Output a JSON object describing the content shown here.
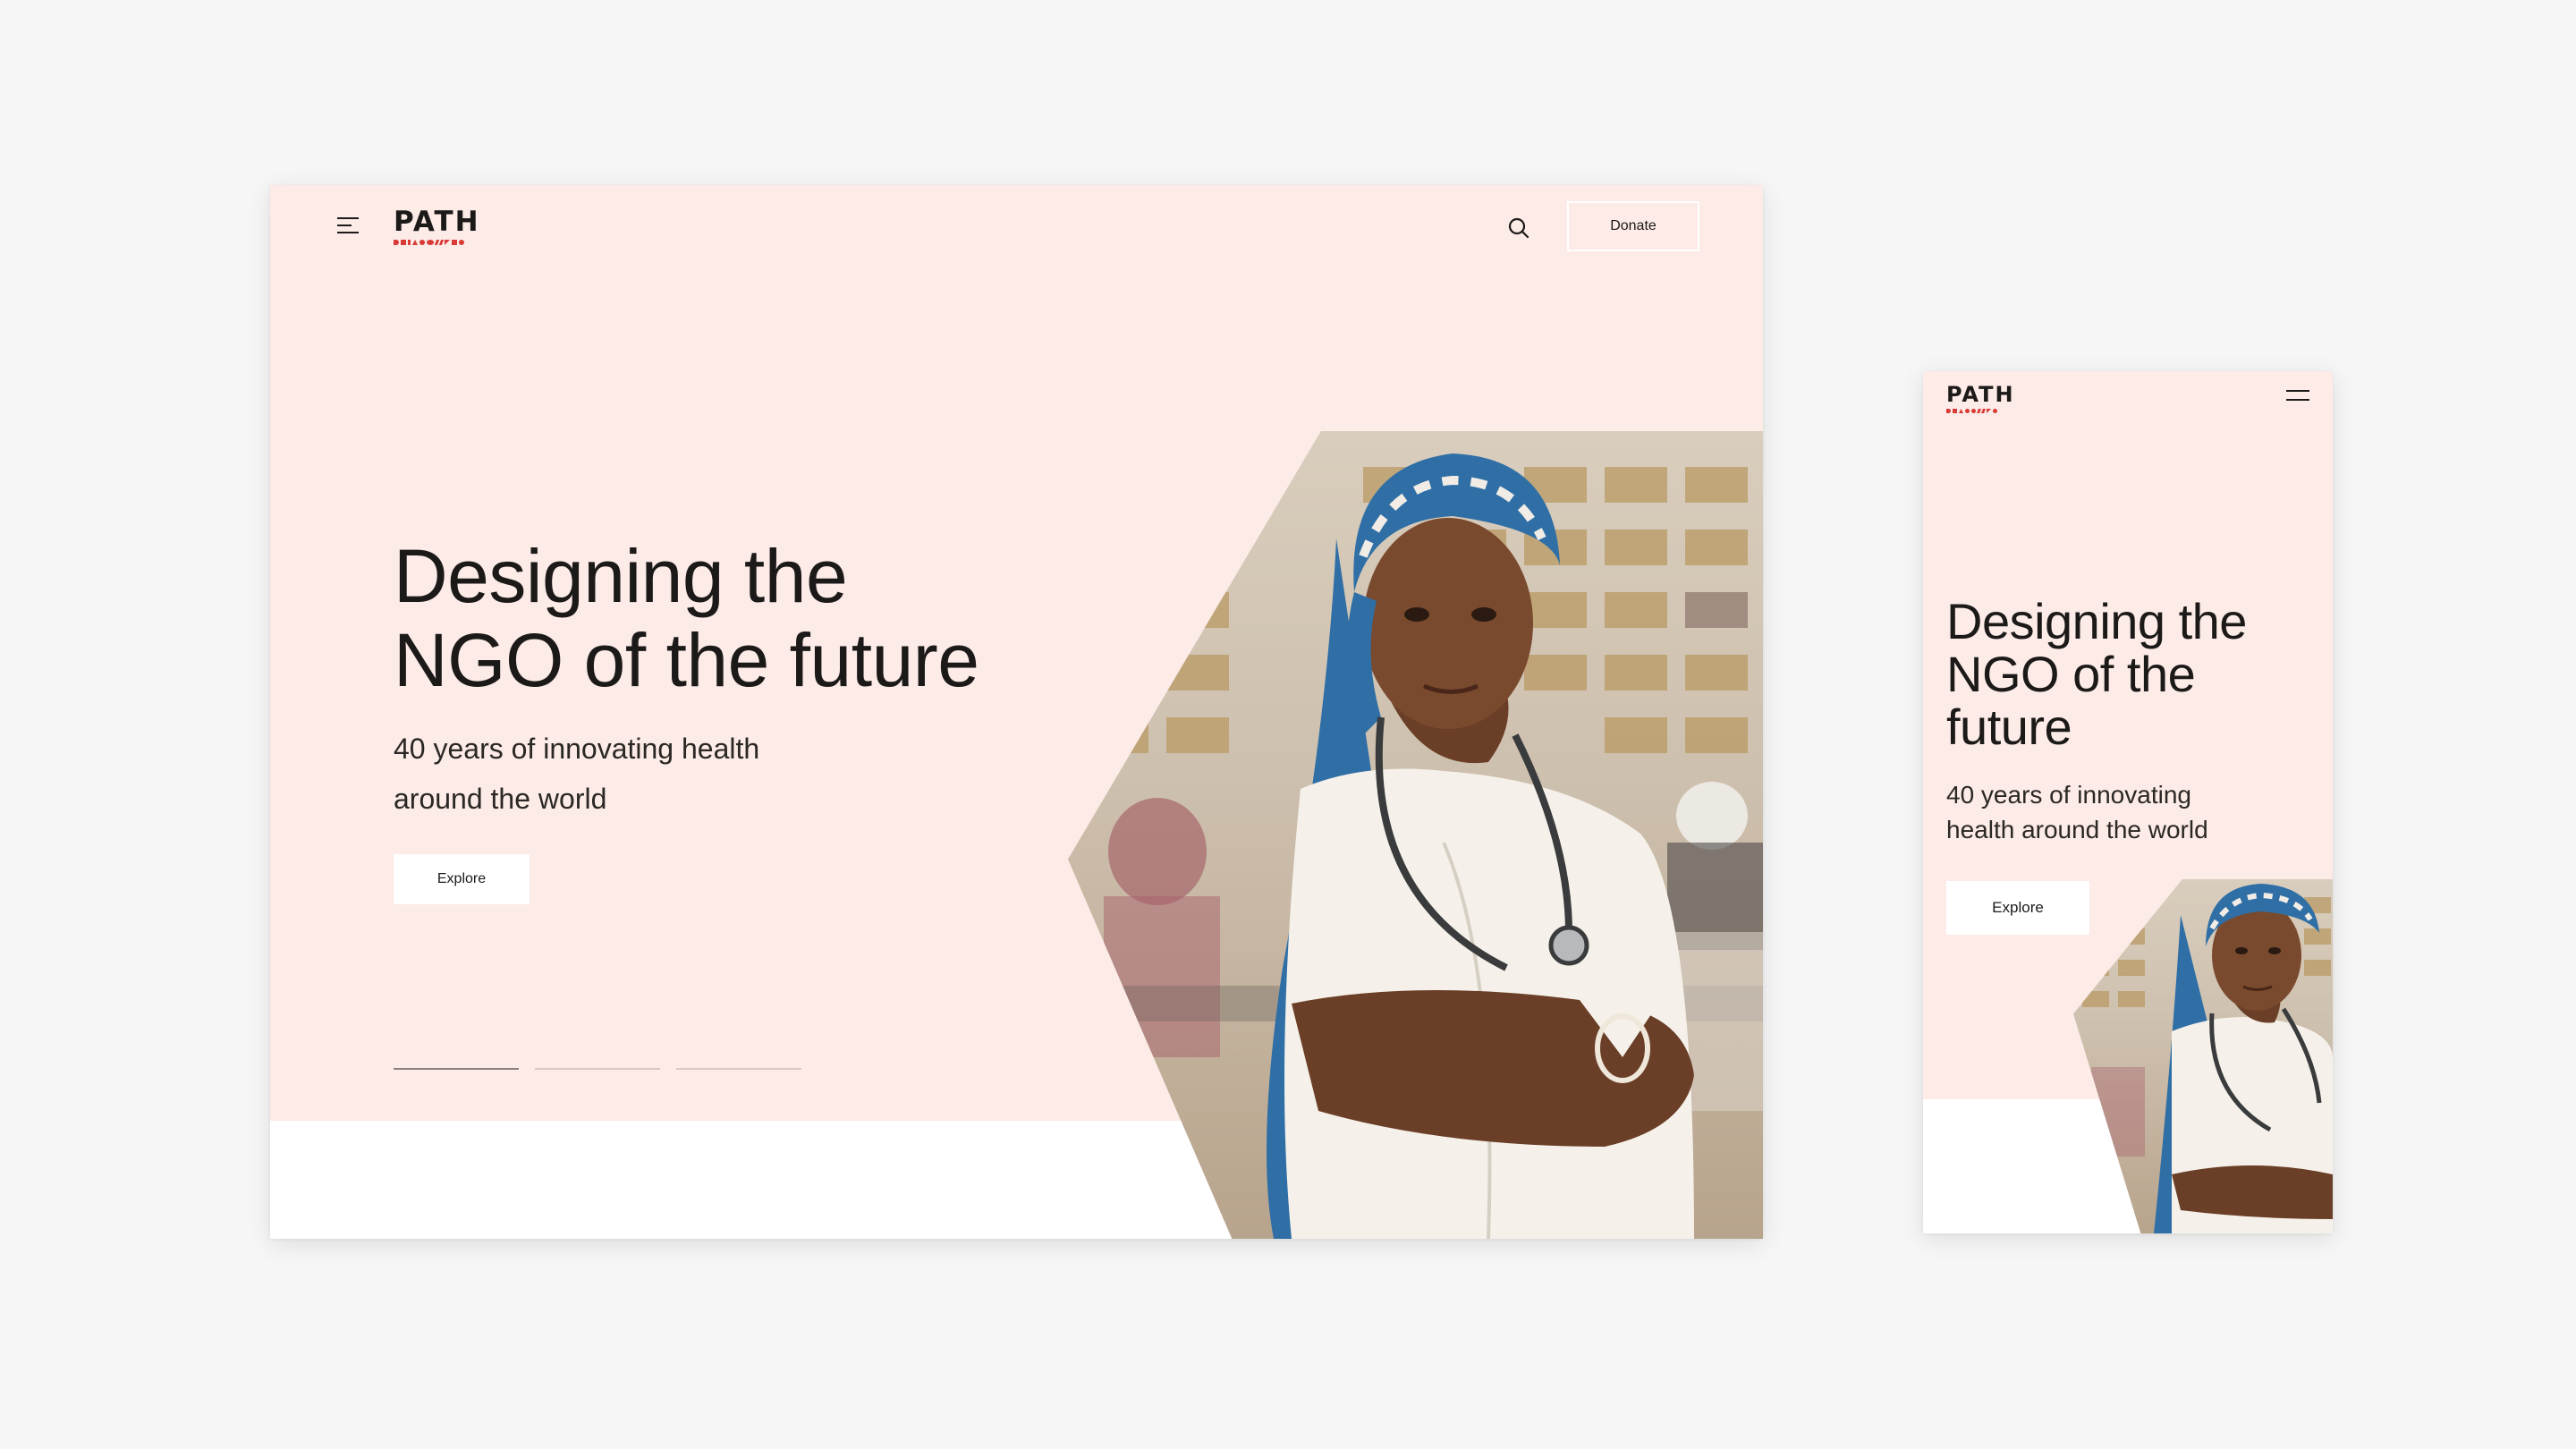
{
  "brand": {
    "name": "PATH"
  },
  "header": {
    "donate_label": "Donate"
  },
  "hero": {
    "title_line1": "Designing the",
    "title_line2": "NGO of the future",
    "subtitle_line1": "40 years of innovating health",
    "subtitle_line2": "around the world",
    "explore_label": "Explore",
    "slides": [
      {
        "active": true
      },
      {
        "active": false
      },
      {
        "active": false
      }
    ]
  },
  "mobile": {
    "title_line1": "Designing the",
    "title_line2": "NGO of the",
    "title_line3": "future",
    "subtitle_line1": "40 years of innovating",
    "subtitle_line2": "health around the world",
    "explore_label": "Explore"
  },
  "colors": {
    "page_bg": "#f6f6f6",
    "hero_bg": "#fcebe6",
    "logo_accent": "#d93a36",
    "text": "#1c1a19"
  },
  "icons": [
    "menu-icon",
    "search-icon",
    "logo-glyphs"
  ]
}
